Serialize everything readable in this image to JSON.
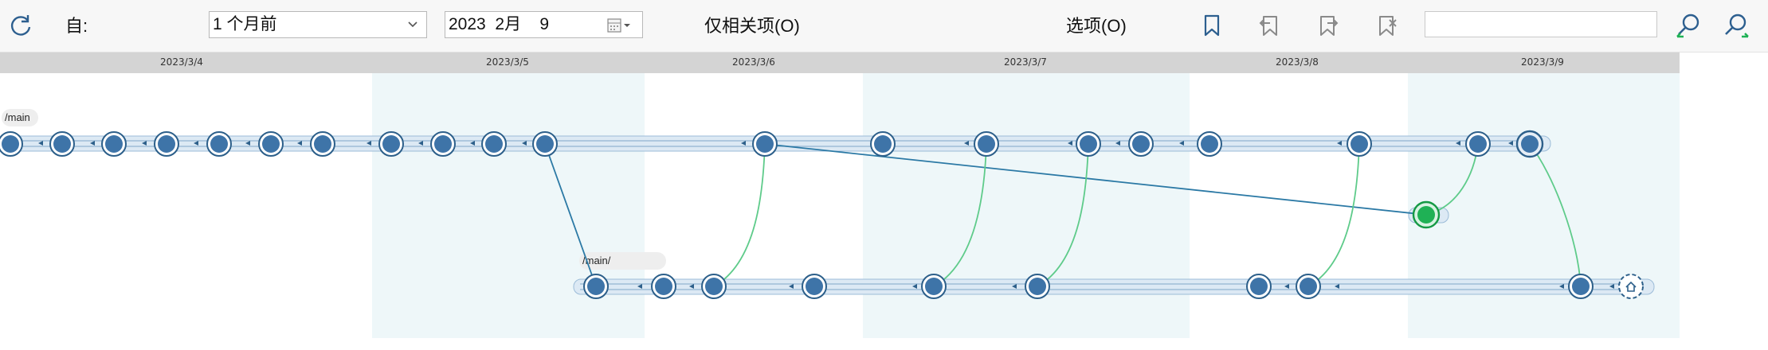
{
  "toolbar": {
    "from_label": "自:",
    "period_value": "1 个月前",
    "date_value": "2023  2月    9",
    "related_label": "仅相关项(O)",
    "options_label": "选项(O)",
    "search_value": ""
  },
  "dates": [
    "2023/3/4",
    "2023/3/5",
    "2023/3/6",
    "2023/3/7",
    "2023/3/8",
    "2023/3/9"
  ],
  "branches": {
    "main_label": "/main",
    "feature_label": "/main/"
  },
  "icons": {
    "refresh": "refresh-icon",
    "calendar": "calendar-icon",
    "bookmark": "bookmark-icon",
    "bookmark_prev": "bookmark-prev-icon",
    "bookmark_next": "bookmark-next-icon",
    "bookmark_clear": "bookmark-clear-icon",
    "find_prev": "search-prev-icon",
    "find_next": "search-next-icon",
    "home": "home-icon"
  },
  "colors": {
    "node": "#3e74a8",
    "node_ring": "#2c5f8a",
    "track": "#bcd5ea",
    "merge_line": "#5ecb8a",
    "branch_line": "#2b79a5",
    "current_node": "#1fb155",
    "band": "#eef7f9",
    "datebar": "#d4d4d4"
  }
}
